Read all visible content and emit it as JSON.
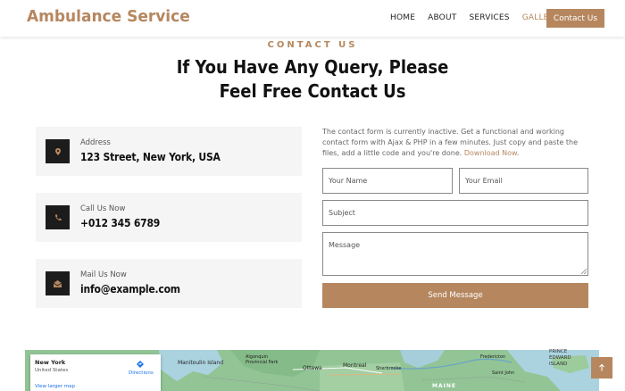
{
  "header": {
    "logo": "Ambulance Service",
    "nav": [
      "HOME",
      "ABOUT",
      "SERVICES",
      "GALLERY"
    ],
    "contact_button": "Contact Us"
  },
  "section": {
    "eyebrow": "CONTACT US",
    "title": "If You Have Any Query, Please Feel Free Contact Us"
  },
  "contacts": [
    {
      "label": "Address",
      "value": "123 Street, New York, USA",
      "icon": "map-pin-icon"
    },
    {
      "label": "Call Us Now",
      "value": "+012 345 6789",
      "icon": "phone-icon"
    },
    {
      "label": "Mail Us Now",
      "value": "info@example.com",
      "icon": "envelope-icon"
    }
  ],
  "form": {
    "intro": "The contact form is currently inactive. Get a functional and working contact form with Ajax & PHP in a few minutes. Just copy and paste the files, add a little code and you're done.",
    "download_link": "Download Now",
    "name_placeholder": "Your Name",
    "email_placeholder": "Your Email",
    "subject_placeholder": "Subject",
    "message_placeholder": "Message",
    "submit": "Send Message"
  },
  "map": {
    "city": "New York",
    "country": "United States",
    "directions": "Directions",
    "larger_map": "View larger map",
    "labels": [
      "Ottawa",
      "Montreal",
      "Sherbrooke",
      "Algonquin Provincial Park",
      "Manitoulin Island",
      "PRINCE EDWARD ISLAND",
      "MAINE",
      "Fredericton",
      "Saint John"
    ]
  },
  "colors": {
    "accent": "#b6875f",
    "dark": "#1c1c1c",
    "card_bg": "#f5f5f5"
  }
}
